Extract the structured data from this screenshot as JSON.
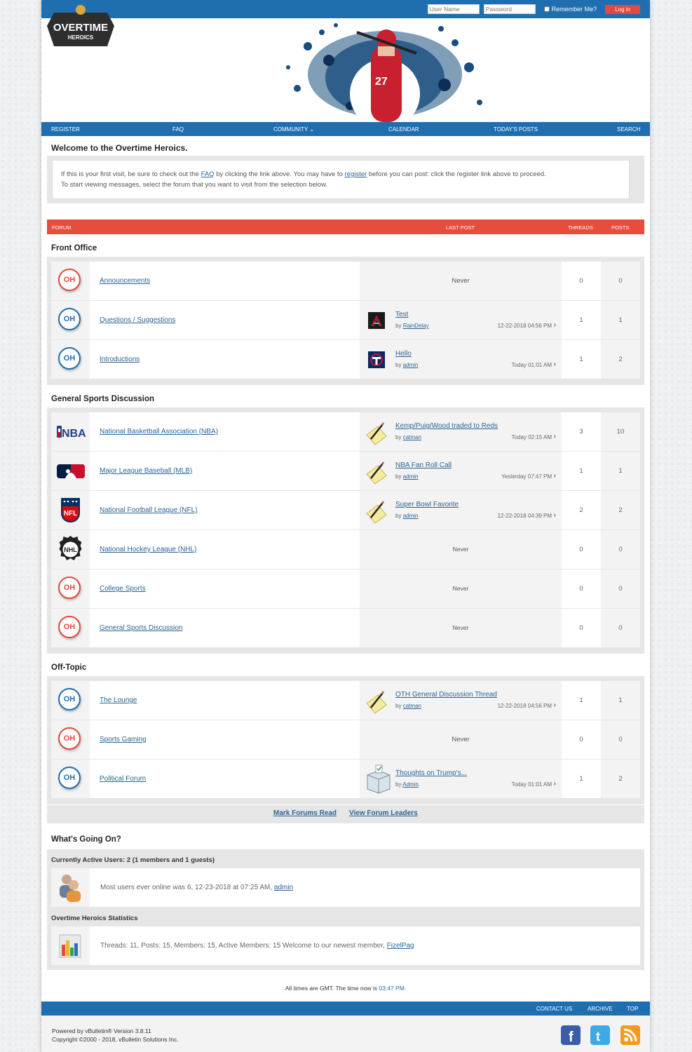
{
  "login": {
    "username_placeholder": "User Name",
    "password_placeholder": "Password",
    "remember_label": "Remember Me?",
    "login_button": "Log in"
  },
  "logo": {
    "line1": "OVERTIME",
    "line2": "HEROICS"
  },
  "nav": {
    "register": "REGISTER",
    "faq": "FAQ",
    "community": "COMMUNITY",
    "calendar": "CALENDAR",
    "todays_posts": "TODAY'S POSTS",
    "search": "SEARCH"
  },
  "welcome": {
    "title": "Welcome to the Overtime Heroics.",
    "line1_pre": "If this is your first visit, be sure to check out the ",
    "faq_link": "FAQ",
    "line1_mid": " by clicking the link above. You may have to ",
    "register_link": "register",
    "line1_post": " before you can post: click the register link above to proceed.",
    "line2": "To start viewing messages, select the forum that you want to visit from the selection below."
  },
  "forum_header": {
    "forum": "FORUM",
    "last_post": "LAST POST",
    "threads": "THREADS",
    "posts": "POSTS"
  },
  "categories": [
    {
      "title": "Front Office",
      "forums": [
        {
          "icon": "oh-red-icon",
          "name": "Announcements",
          "last_post": null,
          "never": "Never",
          "threads": "0",
          "posts": "0"
        },
        {
          "icon": "oh-blue-icon",
          "name": "Questions / Suggestions",
          "last_post": {
            "title": "Test",
            "by": "by",
            "user": "RainDelay",
            "date": "12-22-2018 04:56 PM",
            "thumb": "diamondbacks-logo-icon"
          },
          "threads": "1",
          "posts": "1"
        },
        {
          "icon": "oh-blue-icon",
          "name": "Introductions",
          "last_post": {
            "title": "Hello",
            "by": "by",
            "user": "admin",
            "date": "Today 01:01 AM",
            "thumb": "twins-logo-icon"
          },
          "threads": "1",
          "posts": "2"
        }
      ]
    },
    {
      "title": "General Sports Discussion",
      "forums": [
        {
          "icon": "nba-logo-icon",
          "name": "National Basketball Association (NBA)",
          "last_post": {
            "title": "Kemp/Puig/Wood traded to Reds",
            "by": "by",
            "user": "catman",
            "date": "Today 02:15 AM",
            "thumb": "pencil-paper-icon"
          },
          "threads": "3",
          "posts": "10"
        },
        {
          "icon": "mlb-logo-icon",
          "name": "Major League Baseball (MLB)",
          "last_post": {
            "title": "NBA Fan Roll Call",
            "by": "by",
            "user": "admin",
            "date": "Yesterday 07:47 PM",
            "thumb": "pencil-paper-icon"
          },
          "threads": "1",
          "posts": "1"
        },
        {
          "icon": "nfl-logo-icon",
          "name": "National Football League (NFL)",
          "last_post": {
            "title": "Super Bowl Favorite",
            "by": "by",
            "user": "admin",
            "date": "12-22-2018 04:39 PM",
            "thumb": "pencil-paper-icon"
          },
          "threads": "2",
          "posts": "2"
        },
        {
          "icon": "nhl-logo-icon",
          "name": "National Hockey League (NHL)",
          "last_post": null,
          "never": "Never",
          "threads": "0",
          "posts": "0"
        },
        {
          "icon": "oh-red-icon",
          "name": "College Sports",
          "last_post": null,
          "never": "Never",
          "threads": "0",
          "posts": "0"
        },
        {
          "icon": "oh-red-icon",
          "name": "General Sports Discussion",
          "last_post": null,
          "never": "Never",
          "threads": "0",
          "posts": "0"
        }
      ]
    },
    {
      "title": "Off-Topic",
      "forums": [
        {
          "icon": "oh-blue-icon",
          "name": "The Lounge",
          "last_post": {
            "title": "OTH General Discussion Thread",
            "by": "by",
            "user": "catman",
            "date": "12-22-2018 04:56 PM",
            "thumb": "pencil-paper-icon"
          },
          "threads": "1",
          "posts": "1"
        },
        {
          "icon": "oh-red-icon",
          "name": "Sports Gaming",
          "last_post": null,
          "never": "Never",
          "threads": "0",
          "posts": "0"
        },
        {
          "icon": "oh-blue-icon",
          "name": "Political Forum",
          "last_post": {
            "title": "Thoughts on Trump's...",
            "by": "by",
            "user": "Admin",
            "date": "Today 01:01 AM",
            "thumb": "ballot-box-icon"
          },
          "threads": "1",
          "posts": "2"
        }
      ]
    }
  ],
  "forum_links": {
    "mark_read": "Mark Forums Read",
    "leaders": "View Forum Leaders"
  },
  "whats_going_on": {
    "title": "What's Going On?",
    "active_users_head": "Currently Active Users: 2 (1 members and 1 guests)",
    "active_users_text": "Most users ever online was 6, 12-23-2018 at 07:25 AM, ",
    "active_users_link": "admin",
    "stats_head": "Overtime Heroics Statistics",
    "stats_text": "Threads: 11, Posts: 15, Members: 15, Active Members: 15 Welcome to our newest member, ",
    "stats_link": "FizelPag"
  },
  "time_note": {
    "text": "All times are GMT. The time now is ",
    "time": "03:47 PM."
  },
  "footer_nav": {
    "contact": "CONTACT US",
    "archive": "ARCHIVE",
    "top": "TOP"
  },
  "footer": {
    "powered": "Powered by vBulletin® Version 3.8.11",
    "copyright": "Copyright ©2000 - 2018, vBulletin Solutions Inc."
  },
  "colors": {
    "brand_blue": "#1f6fb0",
    "accent_red": "#e74c3c",
    "link": "#2a6496"
  }
}
